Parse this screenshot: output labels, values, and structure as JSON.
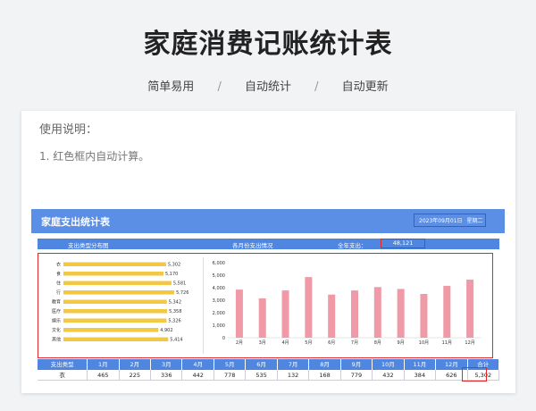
{
  "page": {
    "title": "家庭消费记账统计表",
    "features": [
      "简单易用",
      "自动统计",
      "自动更新"
    ],
    "separator": "/"
  },
  "usage": {
    "title": "使用说明：",
    "items": [
      "1. 红色框内自动计算。"
    ]
  },
  "sheet": {
    "title": "家庭支出统计表",
    "date": "2023年09月01日",
    "weekday": "星期二",
    "left_chart_label": "支出类型分布图",
    "right_chart_label": "各月份支出情况",
    "annual_label": "全年支出：",
    "annual_total": "48,121",
    "accent_color": "#5b8fe6",
    "border_color": "#e02828"
  },
  "chart_data": [
    {
      "type": "bar",
      "orientation": "horizontal",
      "title": "支出类型分布图",
      "categories": [
        "衣",
        "食",
        "住",
        "行",
        "教育",
        "医疗",
        "娱乐",
        "文化",
        "其他"
      ],
      "values": [
        5302,
        5170,
        5581,
        5726,
        5342,
        5358,
        5326,
        4902,
        5414
      ],
      "value_labels": [
        "5,302",
        "5,170",
        "5,581",
        "5,726",
        "5,342",
        "5,358",
        "5,326",
        "4,902",
        "5,414"
      ],
      "color": "#f2c744"
    },
    {
      "type": "bar",
      "title": "各月份支出情况",
      "categories": [
        "2月",
        "3月",
        "4月",
        "5月",
        "6月",
        "7月",
        "8月",
        "9月",
        "10月",
        "11月",
        "12月"
      ],
      "values": [
        3850,
        3150,
        3780,
        4850,
        3450,
        3780,
        4050,
        3900,
        3500,
        4150,
        4650
      ],
      "y_ticks": [
        "0",
        "1,000",
        "2,000",
        "3,000",
        "4,000",
        "5,000",
        "6,000"
      ],
      "ylim": [
        0,
        6000
      ],
      "color": "#ef9aa6"
    }
  ],
  "table": {
    "headers": [
      "支出类型",
      "1月",
      "2月",
      "3月",
      "4月",
      "5月",
      "6月",
      "7月",
      "8月",
      "9月",
      "10月",
      "11月",
      "12月",
      "合计"
    ],
    "rows": [
      [
        "衣",
        "465",
        "225",
        "336",
        "442",
        "778",
        "535",
        "132",
        "168",
        "779",
        "432",
        "384",
        "626",
        "5,302"
      ]
    ]
  }
}
